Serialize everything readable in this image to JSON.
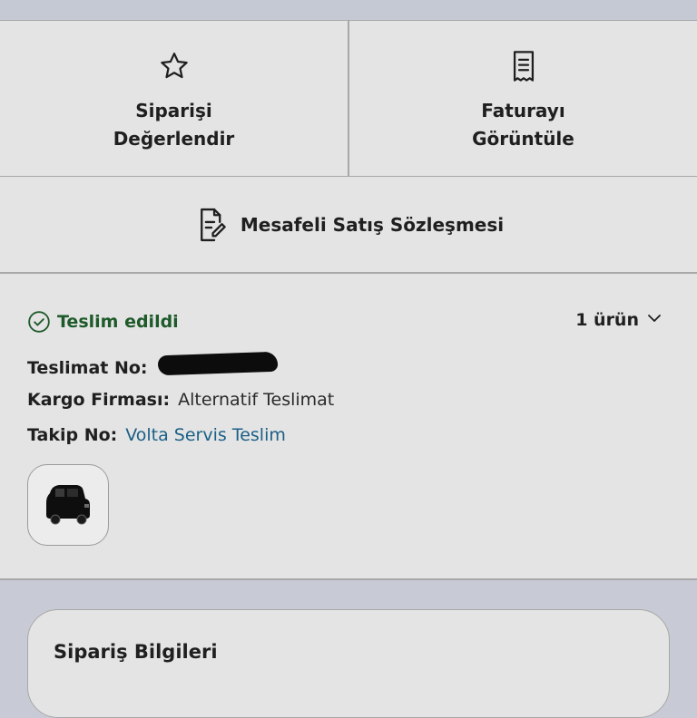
{
  "actions": {
    "rate_order": "Siparişi Değerlendir",
    "view_invoice": "Faturayı Görüntüle"
  },
  "contract": {
    "label": "Mesafeli Satış Sözleşmesi"
  },
  "shipment": {
    "status": "Teslim edildi",
    "item_count": "1 ürün",
    "delivery_no_label": "Teslimat No:",
    "cargo_label": "Kargo Firması:",
    "cargo_value": "Alternatif Teslimat",
    "tracking_label": "Takip No:",
    "tracking_value": "Volta Servis Teslim"
  },
  "order_info": {
    "title": "Sipariş Bilgileri"
  },
  "colors": {
    "status_green": "#1e5a2a",
    "link_blue": "#1a5f86"
  },
  "icons": [
    "star-icon",
    "receipt-icon",
    "document-edit-icon",
    "check-circle-icon",
    "chevron-down-icon",
    "vehicle-icon"
  ]
}
